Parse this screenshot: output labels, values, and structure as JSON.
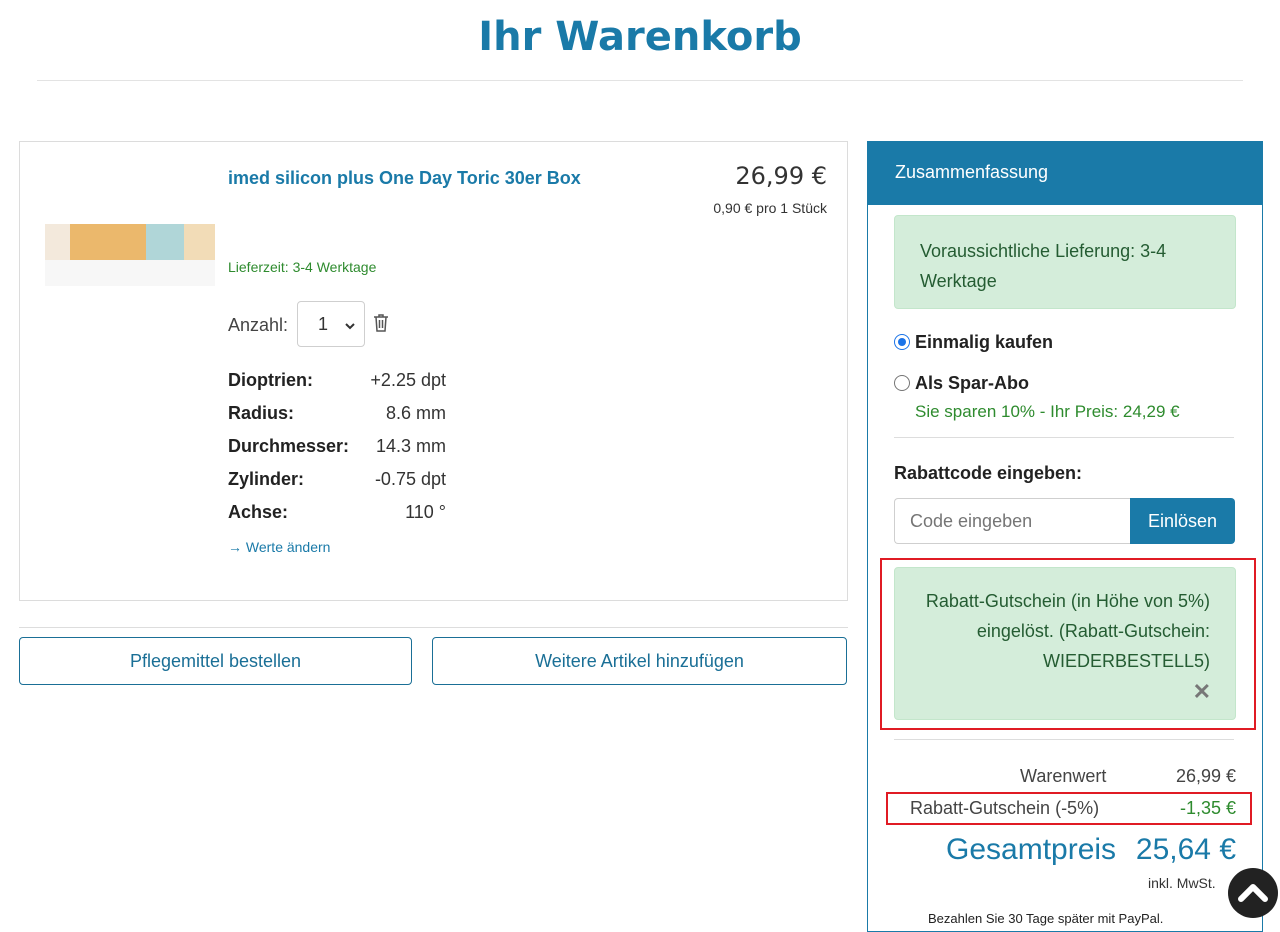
{
  "page": {
    "title": "Ihr Warenkorb"
  },
  "colors": {
    "accent": "#1a7aa8",
    "success_bg": "#d4edda",
    "success_text": "#2e8b2e",
    "highlight": "#e01b24"
  },
  "product": {
    "name": "imed silicon plus One Day Toric 30er Box",
    "price": "26,99 €",
    "unit_price": "0,90 € pro 1 Stück",
    "delivery": "Lieferzeit: 3-4 Werktage",
    "quantity_label": "Anzahl:",
    "quantity_value": "1",
    "image_swatches": [
      "#f3e9dc",
      "#ebb86c",
      "#b0d6d8",
      "#f2dcb7"
    ],
    "specs": [
      {
        "label": "Dioptrien:",
        "value": "+2.25 dpt"
      },
      {
        "label": "Radius:",
        "value": "8.6 mm"
      },
      {
        "label": "Durchmesser:",
        "value": "14.3 mm"
      },
      {
        "label": "Zylinder:",
        "value": "-0.75 dpt"
      },
      {
        "label": "Achse:",
        "value": "110 °"
      }
    ],
    "change_link": "→ Werte ändern"
  },
  "actions": {
    "care_button": "Pflegemittel bestellen",
    "add_more_button": "Weitere Artikel hinzufügen"
  },
  "summary": {
    "header": "Zusammenfassung",
    "delivery_notice": "Voraussichtliche Lieferung: 3-4 Werktage",
    "option_once": "Einmalig kaufen",
    "option_abo": "Als Spar-Abo",
    "abo_savings": "Sie sparen 10% - Ihr Preis: 24,29 €",
    "coupon_label": "Rabattcode eingeben:",
    "coupon_placeholder": "Code eingeben",
    "coupon_button": "Einlösen",
    "coupon_notice": "Rabatt-Gutschein (in Höhe von 5%) eingelöst. (Rabatt-Gutschein: WIEDERBESTELL5)",
    "coupon_remove": "✕",
    "goods_label": "Warenwert",
    "goods_value": "26,99 €",
    "discount_label": "Rabatt-Gutschein (-5%)",
    "discount_value": "-1,35 €",
    "total_label": "Gesamtpreis",
    "total_value": "25,64 €",
    "vat_note": "inkl. MwSt.",
    "paypal_note": "Bezahlen Sie 30 Tage später mit PayPal."
  }
}
